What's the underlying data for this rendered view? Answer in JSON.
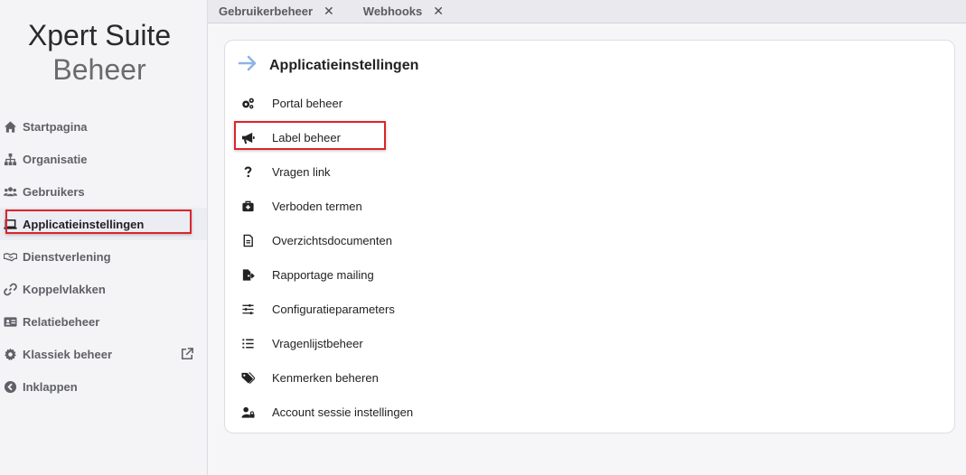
{
  "brand": {
    "line1": "Xpert Suite",
    "line2": "Beheer"
  },
  "sidebar": {
    "items": [
      {
        "label": "Startpagina",
        "icon": "home-icon"
      },
      {
        "label": "Organisatie",
        "icon": "sitemap-icon"
      },
      {
        "label": "Gebruikers",
        "icon": "users-icon"
      },
      {
        "label": "Applicatieinstellingen",
        "icon": "laptop-icon",
        "active": true
      },
      {
        "label": "Dienstverlening",
        "icon": "handshake-icon"
      },
      {
        "label": "Koppelvlakken",
        "icon": "link-icon"
      },
      {
        "label": "Relatiebeheer",
        "icon": "id-card-icon"
      },
      {
        "label": "Klassiek beheer",
        "icon": "gear-icon",
        "external": "external-link-icon"
      },
      {
        "label": "Inklappen",
        "icon": "chevron-left-circle-icon"
      }
    ]
  },
  "tabs": [
    {
      "label": "Gebruikerbeheer",
      "close": "✕"
    },
    {
      "label": "Webhooks",
      "close": "✕"
    }
  ],
  "panel": {
    "title": "Applicatieinstellingen",
    "title_icon": "arrow-right-icon",
    "items": [
      {
        "label": "Portal beheer",
        "icon": "cogs-icon"
      },
      {
        "label": "Label beheer",
        "icon": "megaphone-icon"
      },
      {
        "label": "Vragen link",
        "icon": "question-icon"
      },
      {
        "label": "Verboden termen",
        "icon": "medkit-icon"
      },
      {
        "label": "Overzichtsdocumenten",
        "icon": "document-icon"
      },
      {
        "label": "Rapportage mailing",
        "icon": "file-export-icon"
      },
      {
        "label": "Configuratieparameters",
        "icon": "sliders-icon"
      },
      {
        "label": "Vragenlijstbeheer",
        "icon": "list-icon"
      },
      {
        "label": "Kenmerken beheren",
        "icon": "tags-icon"
      },
      {
        "label": "Account sessie instellingen",
        "icon": "user-lock-icon"
      }
    ]
  },
  "colors": {
    "highlight": "#d9262c",
    "accent_arrow": "#8fb3e6"
  }
}
